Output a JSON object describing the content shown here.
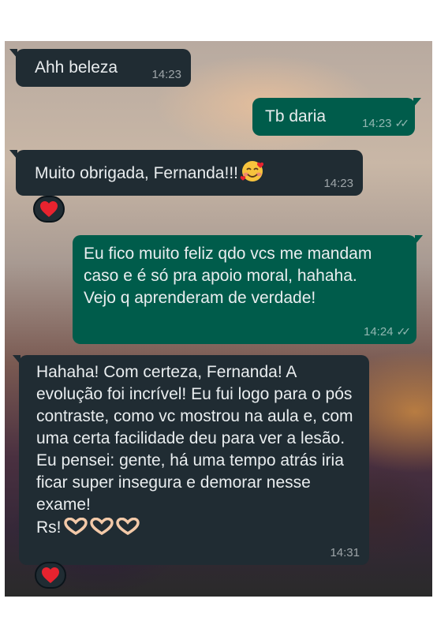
{
  "messages": [
    {
      "direction": "incoming",
      "text": "Ahh beleza",
      "time": "14:23"
    },
    {
      "direction": "outgoing",
      "text": "Tb daria",
      "time": "14:23",
      "status": "read"
    },
    {
      "direction": "incoming",
      "text": "Muito obrigada, Fernanda!!!",
      "emoji": "smiling-face-with-hearts",
      "time": "14:23",
      "reaction": "heart"
    },
    {
      "direction": "outgoing",
      "text": "Eu fico muito feliz qdo vcs me mandam caso e é só pra apoio moral, hahaha. Vejo q aprenderam de verdade!",
      "time": "14:24",
      "status": "read"
    },
    {
      "direction": "incoming",
      "text": "Hahaha! Com certeza, Fernanda! A evolução foi incrível! Eu fui logo para o pós contraste, como vc mostrou na aula e, com uma certa facilidade deu para ver a lesão. Eu pensei: gente, há uma tempo atrás iria ficar super insegura e demorar nesse exame!",
      "text2": "Rs!",
      "emoji": "heart-hands",
      "time": "14:31",
      "reaction": "heart"
    }
  ],
  "colors": {
    "incoming_bubble": "#202c33",
    "outgoing_bubble": "#005c4b",
    "text": "#e9edef",
    "heart": "#e8232f"
  }
}
